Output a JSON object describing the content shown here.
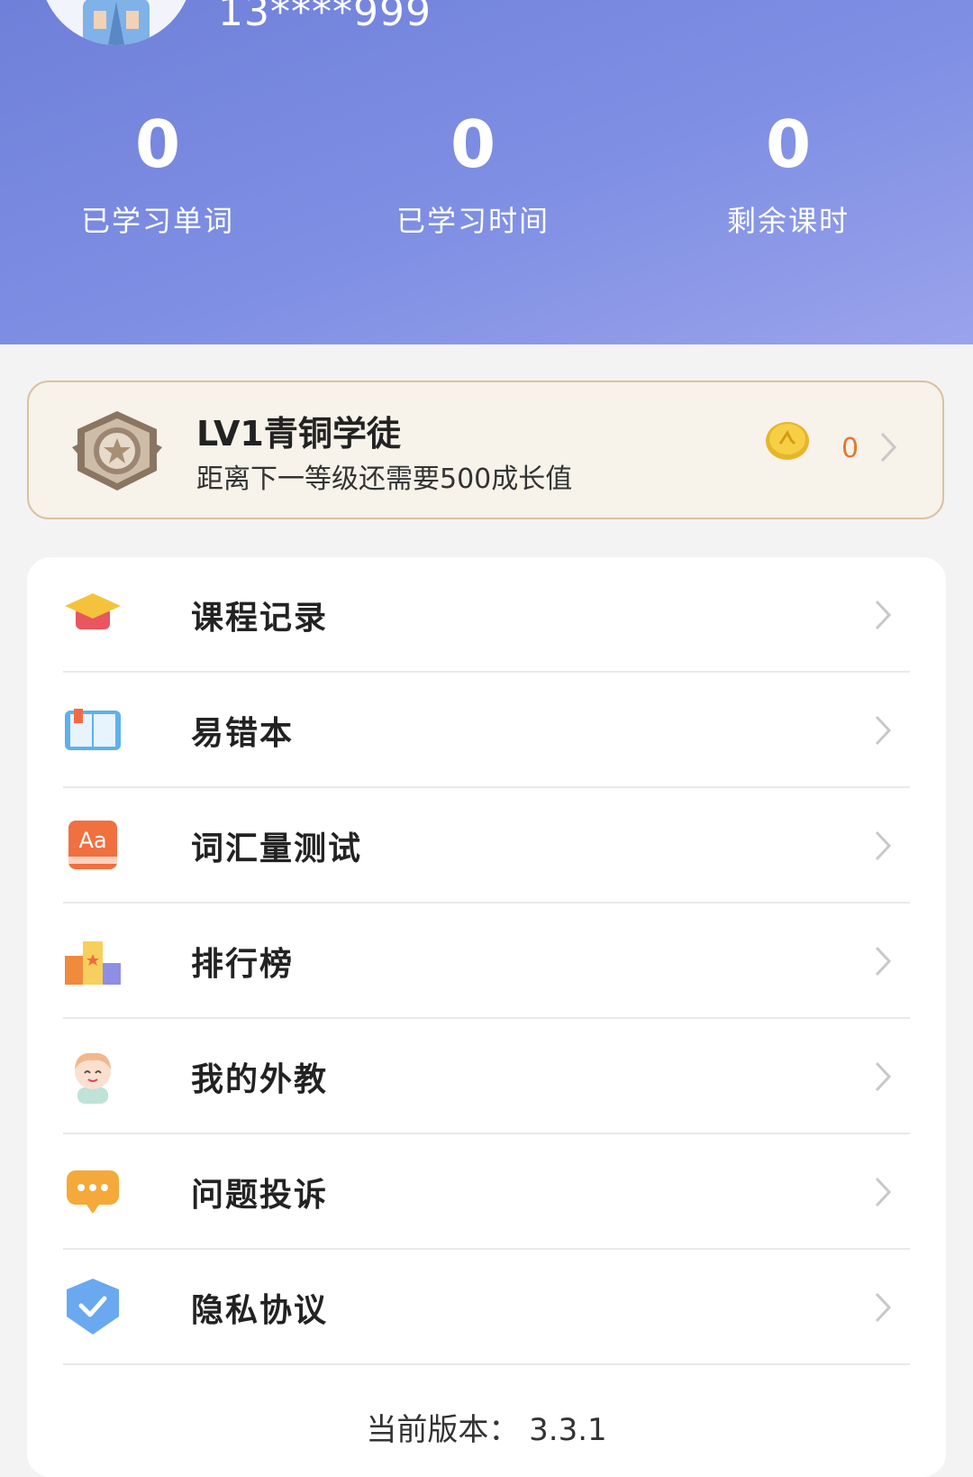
{
  "header": {
    "phone": "13****999",
    "stats": [
      {
        "value": "0",
        "label": "已学习单词"
      },
      {
        "value": "0",
        "label": "已学习时间"
      },
      {
        "value": "0",
        "label": "剩余课时"
      }
    ]
  },
  "level": {
    "title": "LV1青铜学徒",
    "subtitle": "距离下一等级还需要500成长值",
    "coins": "0"
  },
  "menu": [
    {
      "label": "课程记录",
      "icon": "graduation-cap-icon"
    },
    {
      "label": "易错本",
      "icon": "book-icon"
    },
    {
      "label": "词汇量测试",
      "icon": "vocab-test-icon"
    },
    {
      "label": "排行榜",
      "icon": "podium-icon"
    },
    {
      "label": "我的外教",
      "icon": "teacher-icon"
    },
    {
      "label": "问题投诉",
      "icon": "chat-icon"
    },
    {
      "label": "隐私协议",
      "icon": "shield-check-icon"
    }
  ],
  "footer": {
    "version": "当前版本：  3.3.1"
  }
}
